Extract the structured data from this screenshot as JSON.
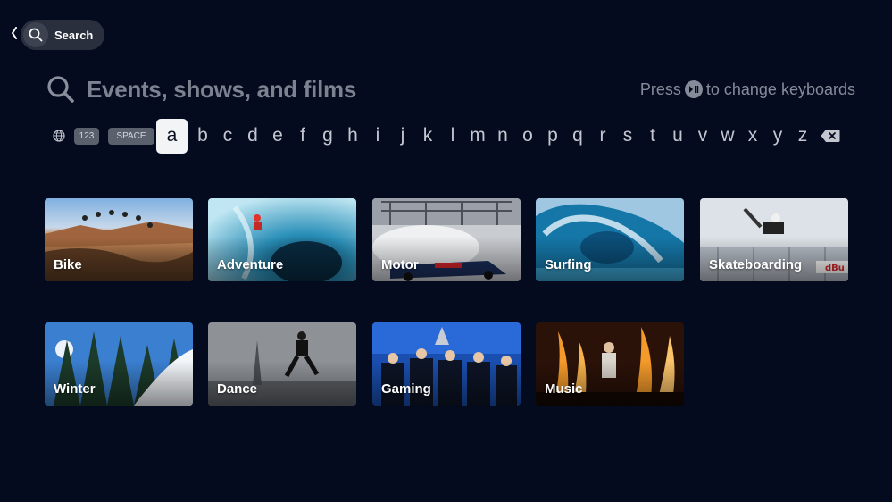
{
  "nav": {
    "search_label": "Search",
    "icons": [
      "back-chevron-icon",
      "search-icon"
    ]
  },
  "search": {
    "placeholder": "Events, shows, and films",
    "hint_prefix": "Press",
    "hint_suffix": "to change keyboards",
    "hint_icon": "play-pause-icon"
  },
  "keyboard": {
    "globe_icon": "globe-icon",
    "numbers_key": "123",
    "space_key": "SPACE",
    "letters": [
      "a",
      "b",
      "c",
      "d",
      "e",
      "f",
      "g",
      "h",
      "i",
      "j",
      "k",
      "l",
      "m",
      "n",
      "o",
      "p",
      "q",
      "r",
      "s",
      "t",
      "u",
      "v",
      "w",
      "x",
      "y",
      "z"
    ],
    "focused_letter": "a",
    "backspace_icon": "backspace-icon"
  },
  "categories": [
    {
      "label": "Bike"
    },
    {
      "label": "Adventure"
    },
    {
      "label": "Motor"
    },
    {
      "label": "Surfing"
    },
    {
      "label": "Skateboarding"
    },
    {
      "label": "Winter"
    },
    {
      "label": "Dance"
    },
    {
      "label": "Gaming"
    },
    {
      "label": "Music"
    }
  ],
  "colors": {
    "background": "#050b1f",
    "focused_key": "#f3f4f6",
    "muted_text": "#7d8291"
  }
}
